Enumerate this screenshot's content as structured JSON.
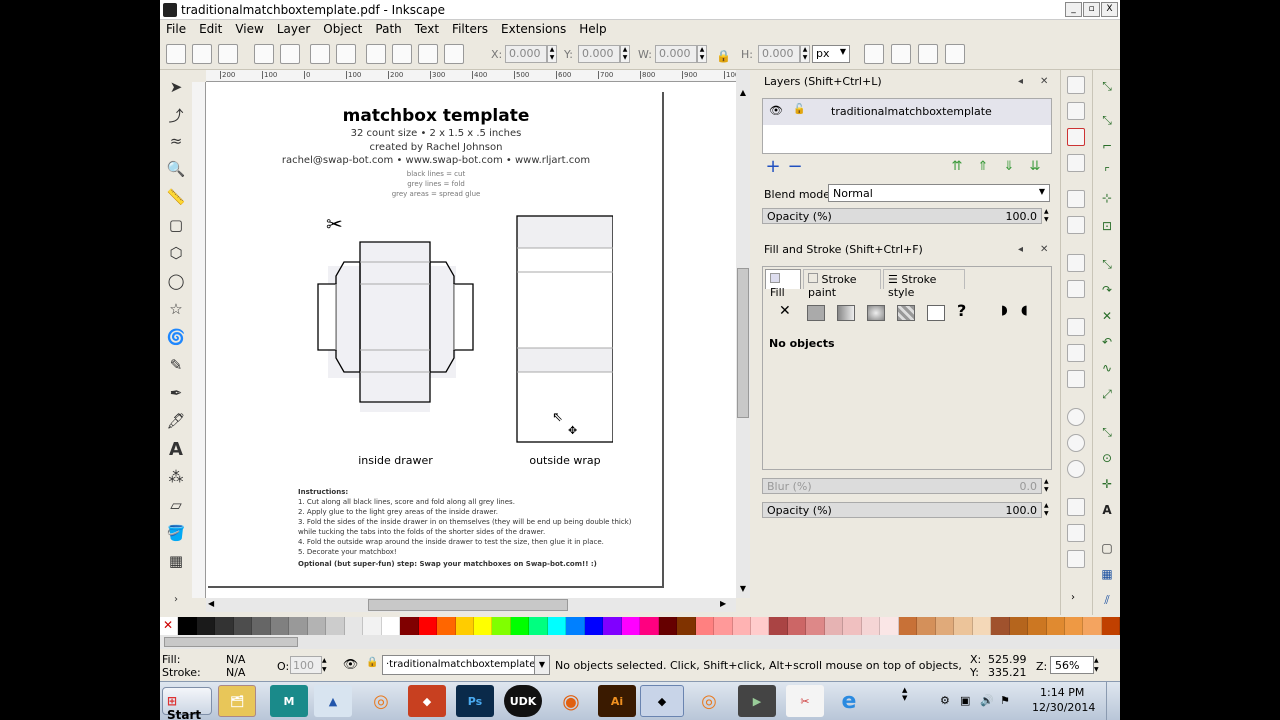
{
  "window": {
    "title": "traditionalmatchboxtemplate.pdf - Inkscape",
    "controls": [
      "_",
      "▫",
      "X"
    ]
  },
  "menu": [
    "File",
    "Edit",
    "View",
    "Layer",
    "Object",
    "Path",
    "Text",
    "Filters",
    "Extensions",
    "Help"
  ],
  "toolbar": {
    "x_label": "X:",
    "x_value": "0.000",
    "y_label": "Y:",
    "y_value": "0.000",
    "w_label": "W:",
    "w_value": "0.000",
    "h_label": "H:",
    "h_value": "0.000",
    "unit": "px"
  },
  "ruler_ticks": [
    "200",
    "100",
    "0",
    "100",
    "200",
    "300",
    "400",
    "500",
    "600",
    "700",
    "800",
    "900",
    "1000"
  ],
  "document": {
    "title": "matchbox template",
    "line1": "32 count size  •  2 x 1.5 x .5 inches",
    "line2": "created by Rachel Johnson",
    "line3": "rachel@swap-bot.com  •  www.swap-bot.com  •  www.rljart.com",
    "legend1": "black lines = cut",
    "legend2": "grey lines = fold",
    "legend3": "grey areas = spread glue",
    "label_drawer": "inside drawer",
    "label_wrap": "outside wrap",
    "instructions_title": "Instructions:",
    "instructions": [
      "1. Cut along all black lines, score and fold along all grey lines.",
      "2. Apply glue to the light grey areas of the inside drawer.",
      "3. Fold the sides of the inside drawer in on themselves (they will be end up being double thick)",
      "   while tucking the tabs into the folds of the shorter sides of the drawer.",
      "4. Fold the outside wrap around the inside drawer to test the size, then glue it in place.",
      "5. Decorate your matchbox!"
    ],
    "optional": "Optional (but super-fun) step: Swap your matchboxes on Swap-bot.com!! :)"
  },
  "layers_panel": {
    "title": "Layers (Shift+Ctrl+L)",
    "layer_name": "traditionalmatchboxtemplate",
    "blend_label": "Blend mode:",
    "blend_value": "Normal",
    "opacity_label": "Opacity (%)",
    "opacity_value": "100.0"
  },
  "fill_panel": {
    "title": "Fill and Stroke (Shift+Ctrl+F)",
    "tabs": [
      "Fill",
      "Stroke paint",
      "Stroke style"
    ],
    "no_objects": "No objects",
    "blur_label": "Blur (%)",
    "blur_value": "0.0",
    "opacity_label": "Opacity (%)",
    "opacity_value": "100.0"
  },
  "palette_colors": [
    "#ffffff",
    "#000000",
    "#1a1a1a",
    "#333333",
    "#4d4d4d",
    "#666666",
    "#808080",
    "#999999",
    "#b3b3b3",
    "#cccccc",
    "#e6e6e6",
    "#f2f2f2",
    "#ffffff",
    "#800000",
    "#ff0000",
    "#ff6600",
    "#ffcc00",
    "#ffff00",
    "#80ff00",
    "#00ff00",
    "#00ff80",
    "#00ffff",
    "#0080ff",
    "#0000ff",
    "#8000ff",
    "#ff00ff",
    "#ff0080",
    "#660000",
    "#803300",
    "#ff8080",
    "#ff9999",
    "#ffb3b3",
    "#ffcccc",
    "#aa4444",
    "#cc6666",
    "#dd8888",
    "#e6b3b3",
    "#f0c0c0",
    "#f5d5d5",
    "#fae6e6",
    "#c87137",
    "#d4905a",
    "#e0aa7a",
    "#ecc49a",
    "#f4d8b8",
    "#a0522d",
    "#b5651d",
    "#cc7722",
    "#e08a30",
    "#ee9944",
    "#f4a460",
    "#c04000"
  ],
  "status": {
    "fill_label": "Fill:",
    "fill_value": "N/A",
    "stroke_label": "Stroke:",
    "stroke_value": "N/A",
    "o_label": "O:",
    "o_value": "100",
    "layer": "·traditionalmatchboxtemplate",
    "message": "No objects selected. Click, Shift+click, Alt+scroll mouse on top of objects, or drag around o",
    "x_label": "X:",
    "x_value": "525.99",
    "y_label": "Y:",
    "y_value": "335.21",
    "z_label": "Z:",
    "zoom": "56%"
  },
  "taskbar": {
    "start": "Start",
    "time": "1:14 PM",
    "date": "12/30/2014",
    "apps": [
      "Photoshop",
      "UDK",
      "Firefox",
      "Illustrator",
      "Inkscape",
      "Blender"
    ]
  }
}
